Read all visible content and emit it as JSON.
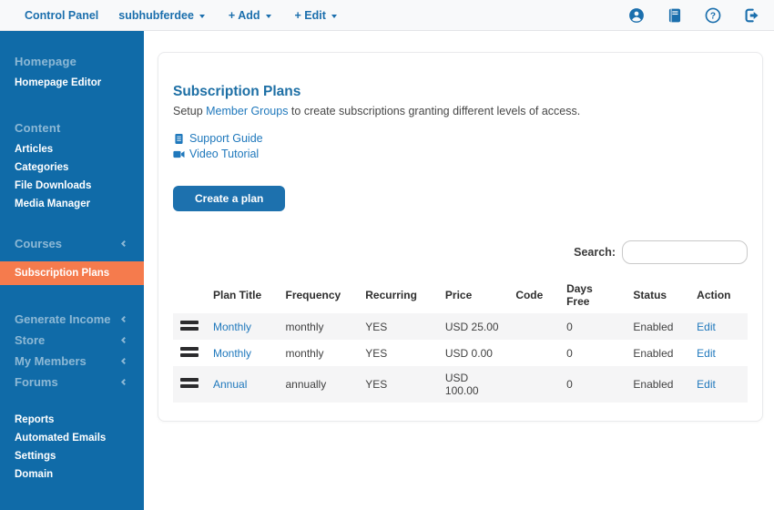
{
  "colors": {
    "sidebar_bg": "#106ba8",
    "active_item_bg": "#f57b4d",
    "brand_blue": "#1b6fad",
    "link_blue": "#1f78bc",
    "button_blue": "#1d71ae",
    "row_stripe": "#f5f5f6",
    "topnav_bg": "#f8f9fa"
  },
  "topnav": {
    "brand": "Control Panel",
    "site_menu": "subhubferdee",
    "add_menu": "+ Add",
    "edit_menu": "+ Edit"
  },
  "sidebar": {
    "items": [
      {
        "label": "Homepage",
        "type": "header"
      },
      {
        "label": "Homepage Editor",
        "type": "link"
      },
      {
        "label": "Content",
        "type": "header"
      },
      {
        "label": "Articles",
        "type": "link"
      },
      {
        "label": "Categories",
        "type": "link"
      },
      {
        "label": "File Downloads",
        "type": "link"
      },
      {
        "label": "Media Manager",
        "type": "link"
      },
      {
        "label": "Courses",
        "type": "collapsible"
      },
      {
        "label": "Subscription Plans",
        "type": "active"
      },
      {
        "label": "Generate Income",
        "type": "collapsible"
      },
      {
        "label": "Store",
        "type": "collapsible"
      },
      {
        "label": "My Members",
        "type": "collapsible"
      },
      {
        "label": "Forums",
        "type": "collapsible"
      },
      {
        "label": "Reports",
        "type": "link"
      },
      {
        "label": "Automated Emails",
        "type": "link"
      },
      {
        "label": "Settings",
        "type": "link"
      },
      {
        "label": "Domain",
        "type": "link"
      }
    ]
  },
  "main": {
    "title": "Subscription Plans",
    "intro": {
      "before": "Setup ",
      "link": "Member Groups",
      "after": " to create subscriptions granting different levels of access."
    },
    "resources": [
      {
        "label": "Support Guide",
        "icon": "document-icon"
      },
      {
        "label": "Video Tutorial",
        "icon": "video-camera-icon"
      }
    ],
    "create_button": "Create a plan",
    "search_label": "Search:",
    "search_value": ""
  },
  "table": {
    "columns": [
      "Plan Title",
      "Frequency",
      "Recurring",
      "Price",
      "Code",
      "Days Free",
      "Status",
      "Action"
    ],
    "rows": [
      {
        "plan_title": "Monthly",
        "frequency": "monthly",
        "recurring": "YES",
        "price": "USD 25.00",
        "code": "",
        "days_free": "0",
        "status": "Enabled",
        "action": "Edit"
      },
      {
        "plan_title": "Monthly",
        "frequency": "monthly",
        "recurring": "YES",
        "price": "USD 0.00",
        "code": "",
        "days_free": "0",
        "status": "Enabled",
        "action": "Edit"
      },
      {
        "plan_title": "Annual",
        "frequency": "annually",
        "recurring": "YES",
        "price": "USD 100.00",
        "code": "",
        "days_free": "0",
        "status": "Enabled",
        "action": "Edit"
      }
    ]
  }
}
